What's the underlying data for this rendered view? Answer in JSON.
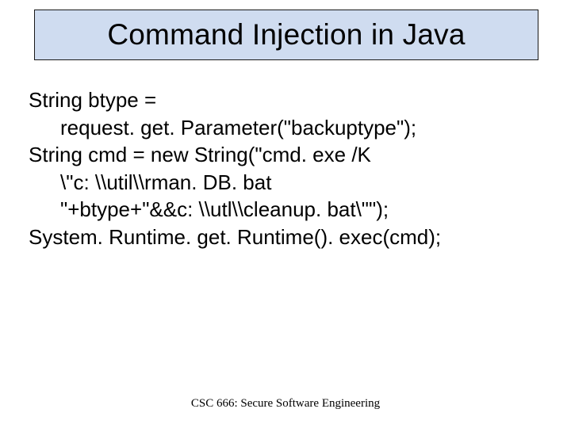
{
  "title": "Command Injection in Java",
  "body": {
    "l1": "String btype =",
    "l2": "request. get. Parameter(\"backuptype\");",
    "l3": "String cmd = new String(\"cmd. exe /K",
    "l4": "\\\"c: \\\\util\\\\rman. DB. bat",
    "l5": "\"+btype+\"&&c: \\\\utl\\\\cleanup. bat\\\"\");",
    "l6": "System. Runtime. get. Runtime(). exec(cmd);"
  },
  "footer": "CSC 666: Secure Software Engineering"
}
